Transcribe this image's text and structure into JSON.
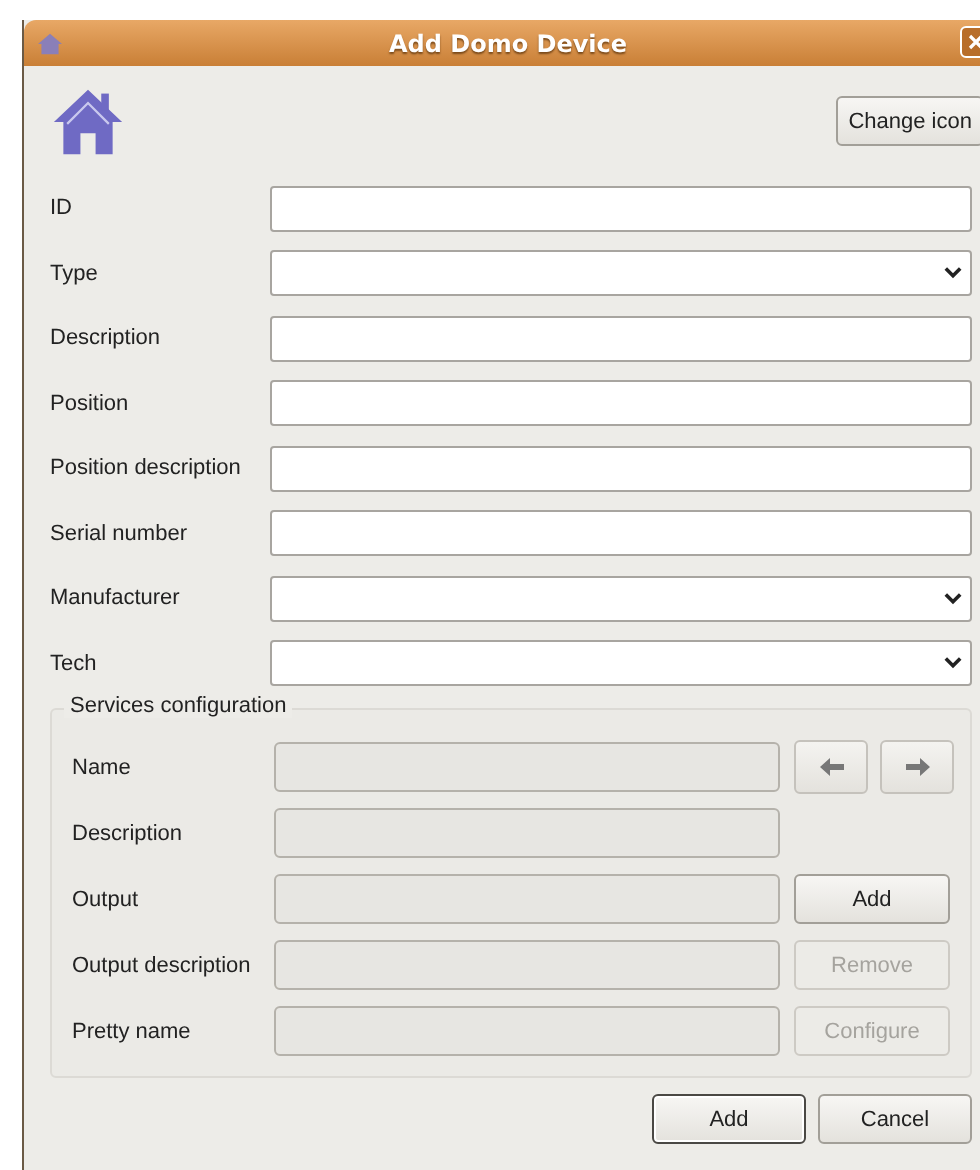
{
  "window": {
    "title": "Add Domo Device"
  },
  "change_icon_button": "Change icon",
  "fields": [
    {
      "label": "ID",
      "kind": "text"
    },
    {
      "label": "Type",
      "kind": "combo"
    },
    {
      "label": "Description",
      "kind": "text"
    },
    {
      "label": "Position",
      "kind": "text"
    },
    {
      "label": "Position description",
      "kind": "text"
    },
    {
      "label": "Serial number",
      "kind": "text"
    },
    {
      "label": "Manufacturer",
      "kind": "combo"
    },
    {
      "label": "Tech",
      "kind": "combo"
    }
  ],
  "services": {
    "title": "Services configuration",
    "rows": [
      {
        "label": "Name",
        "disabled": true,
        "actions": [
          {
            "kind": "prev"
          },
          {
            "kind": "next"
          }
        ]
      },
      {
        "label": "Description",
        "disabled": true,
        "actions": []
      },
      {
        "label": "Output",
        "disabled": true,
        "actions": [
          {
            "kind": "button",
            "label": "Add",
            "disabled": false
          }
        ]
      },
      {
        "label": "Output description",
        "disabled": true,
        "actions": [
          {
            "kind": "button",
            "label": "Remove",
            "disabled": true
          }
        ]
      },
      {
        "label": "Pretty name",
        "disabled": true,
        "actions": [
          {
            "kind": "button",
            "label": "Configure",
            "disabled": true
          }
        ]
      }
    ]
  },
  "buttons": [
    {
      "label": "Add",
      "default": true
    },
    {
      "label": "Cancel",
      "default": false
    }
  ]
}
